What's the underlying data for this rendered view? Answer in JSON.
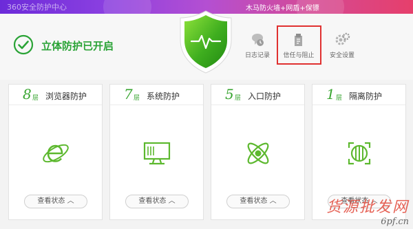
{
  "window": {
    "title": "360安全防护中心",
    "promo_text": "木马防火墙+网盾+保镖"
  },
  "protection_status": {
    "text": "立体防护已开启",
    "color": "#2aa336"
  },
  "toolbar": {
    "items": [
      {
        "label": "日志记录",
        "icon": "log-icon"
      },
      {
        "label": "信任与阻止",
        "icon": "trust-block-icon"
      },
      {
        "label": "安全设置",
        "icon": "gear-icon"
      }
    ]
  },
  "cards": [
    {
      "count": "8",
      "unit": "层",
      "name": "浏览器防护",
      "icon": "browser-icon",
      "button": "查看状态"
    },
    {
      "count": "7",
      "unit": "层",
      "name": "系统防护",
      "icon": "monitor-icon",
      "button": "查看状态"
    },
    {
      "count": "5",
      "unit": "层",
      "name": "入口防护",
      "icon": "atom-icon",
      "button": "查看状态"
    },
    {
      "count": "1",
      "unit": "层",
      "name": "隔离防护",
      "icon": "isolation-icon",
      "button": "查看状态"
    }
  ],
  "watermark": {
    "line1": "货源批发网",
    "line2": "6pf.cn"
  },
  "colors": {
    "accent_green": "#38a530",
    "highlight_red": "#e0302f",
    "topbar_gradient": [
      "#6c2bd9",
      "#e63f6b"
    ]
  }
}
